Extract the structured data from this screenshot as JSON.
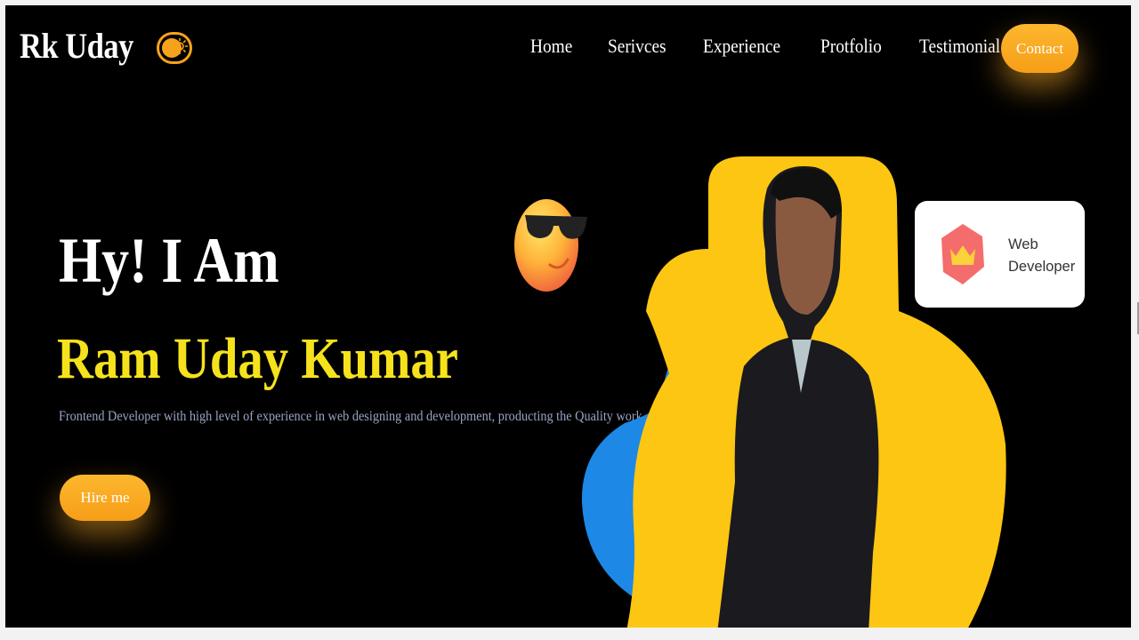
{
  "header": {
    "logo": "Rk Uday",
    "theme_toggle_icon": "sun-icon",
    "nav": [
      "Home",
      "Serivces",
      "Experience",
      "Protfolio",
      "Testimonial"
    ],
    "contact_label": "Contact"
  },
  "hero": {
    "greeting": "Hy! I Am",
    "name": "Ram Uday Kumar",
    "tagline": "Frontend Developer with high level of experience in web designing and development, producting the Quality work",
    "hire_label": "Hire me"
  },
  "badge": {
    "icon": "crown-icon",
    "line1": "Web",
    "line2": "Developer"
  },
  "colors": {
    "background": "#000000",
    "accent": "#f7a21b",
    "name_yellow": "#f5e21c",
    "blob_yellow": "#fdc612",
    "blob_blue": "#1d88e5",
    "tagline": "#9aa4c4"
  }
}
